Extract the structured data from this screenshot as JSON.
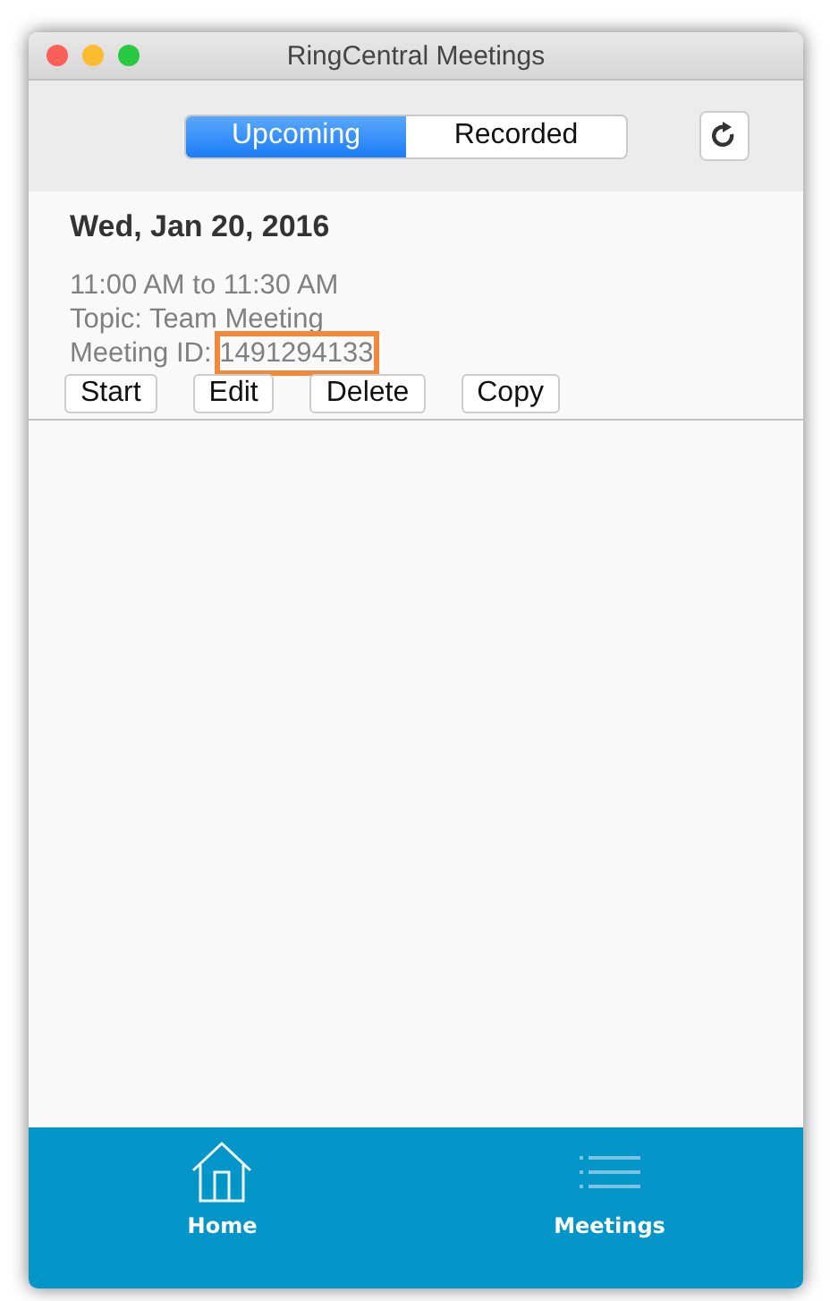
{
  "window": {
    "title": "RingCentral Meetings"
  },
  "segments": [
    {
      "label": "Upcoming",
      "selected": true
    },
    {
      "label": "Recorded",
      "selected": false
    }
  ],
  "meeting": {
    "date": "Wed, Jan 20, 2016",
    "time": "11:00 AM to 11:30 AM",
    "topic": "Topic: Team Meeting",
    "id_label": "Meeting ID:",
    "id": "1491294133",
    "id_highlighted": true,
    "buttons": [
      "Start",
      "Edit",
      "Delete",
      "Copy"
    ]
  },
  "nav": [
    {
      "label": "Home",
      "kind": "home",
      "selected": false
    },
    {
      "label": "Meetings",
      "kind": "list",
      "selected": true
    }
  ]
}
